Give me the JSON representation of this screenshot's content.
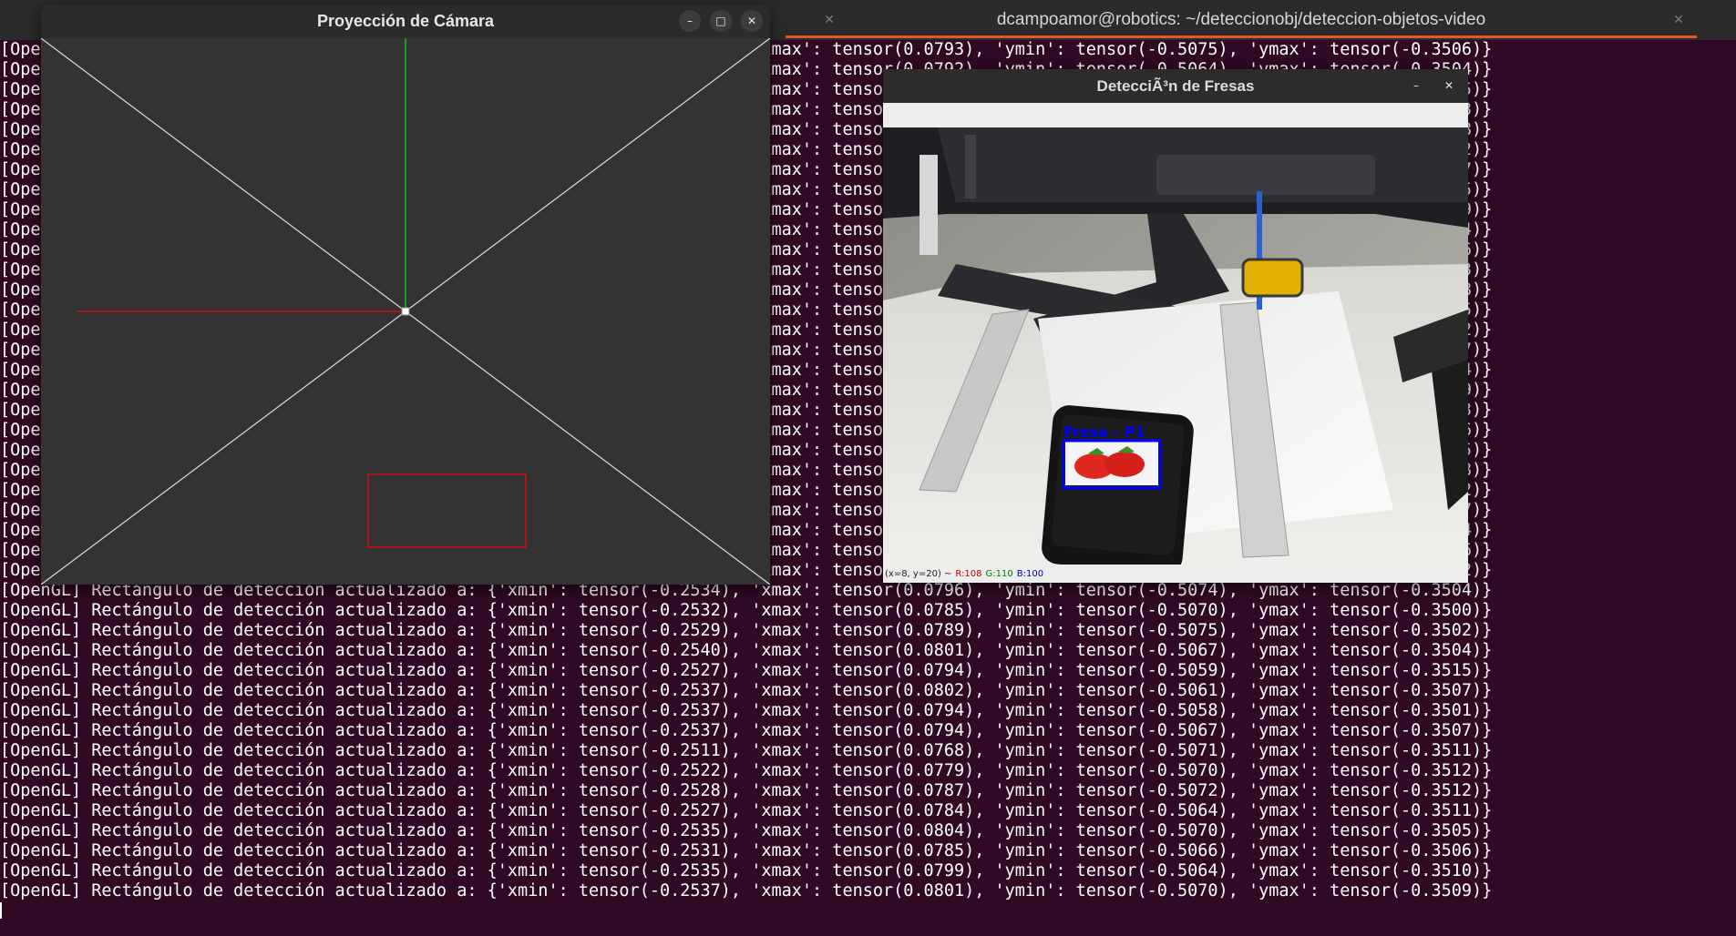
{
  "terminal": {
    "tab_title": "dcampoamor@robotics: ~/deteccionobj/deteccion-objetos-video",
    "line_prefix": "[OpenGL] Rectángulo de detección actualizado a: ",
    "lines": [
      "[OpenGL] Rectángulo de detección actualizado a: {'xmin': tensor(-0.2535), 'xmax': tensor(0.0793), 'ymin': tensor(-0.5075), 'ymax': tensor(-0.3506)}",
      "[OpenGL] Rectángulo de detección actualizado a: {'xmin': tensor(-0.2533), 'xmax': tensor(0.0792), 'ymin': tensor(-0.5064), 'ymax': tensor(-0.3504)}",
      "[OpenGL] Rectángulo de detección actualizado a: {'xmin': tensor(-0.2536), 'xmax': tensor(0.0795), 'ymin': tensor(-0.5068), 'ymax': tensor(-0.3505)}",
      "[OpenGL] Rectángulo de detección actualizado a: {'xmin': tensor(-0.2531), 'xmax': tensor(0.0790), 'ymin': tensor(-0.5071), 'ymax': tensor(-0.3503)}",
      "[OpenGL] Rectángulo de detección actualizado a: {'xmin': tensor(-0.2538), 'xmax': tensor(0.0797), 'ymin': tensor(-0.5066), 'ymax': tensor(-0.3508)}",
      "[OpenGL] Rectángulo de detección actualizado a: {'xmin': tensor(-0.2534), 'xmax': tensor(0.0791), 'ymin': tensor(-0.5072), 'ymax': tensor(-0.3502)}",
      "[OpenGL] Rectángulo de detección actualizado a: {'xmin': tensor(-0.2532), 'xmax': tensor(0.0794), 'ymin': tensor(-0.5069), 'ymax': tensor(-0.3507)}",
      "[OpenGL] Rectángulo de detección actualizado a: {'xmin': tensor(-0.2537), 'xmax': tensor(0.0796), 'ymin': tensor(-0.5063), 'ymax': tensor(-0.3505)}",
      "[OpenGL] Rectángulo de detección actualizado a: {'xmin': tensor(-0.2535), 'xmax': tensor(0.0789), 'ymin': tensor(-0.5070), 'ymax': tensor(-0.3509)}",
      "[OpenGL] Rectángulo de detección actualizado a: {'xmin': tensor(-0.2530), 'xmax': tensor(0.0798), 'ymin': tensor(-0.5067), 'ymax': tensor(-0.3504)}",
      "[OpenGL] Rectángulo de detección actualizado a: {'xmin': tensor(-0.2539), 'xmax': tensor(0.0793), 'ymin': tensor(-0.5074), 'ymax': tensor(-0.3506)}",
      "[OpenGL] Rectángulo de detección actualizado a: {'xmin': tensor(-0.2533), 'xmax': tensor(0.0795), 'ymin': tensor(-0.5061), 'ymax': tensor(-0.3503)}",
      "[OpenGL] Rectángulo de detección actualizado a: {'xmin': tensor(-0.2536), 'xmax': tensor(0.0792), 'ymin': tensor(-0.5068), 'ymax': tensor(-0.3508)}",
      "[OpenGL] Rectángulo de detección actualizado a: {'xmin': tensor(-0.2534), 'xmax': tensor(0.0790), 'ymin': tensor(-0.5073), 'ymax': tensor(-0.3505)}",
      "[OpenGL] Rectángulo de detección actualizado a: {'xmin': tensor(-0.2531), 'xmax': tensor(0.0797), 'ymin': tensor(-0.5065), 'ymax': tensor(-0.3502)}",
      "[OpenGL] Rectángulo de detección actualizado a: {'xmin': tensor(-0.2538), 'xmax': tensor(0.0794), 'ymin': tensor(-0.5070), 'ymax': tensor(-0.3507)}",
      "[OpenGL] Rectángulo de detección actualizado a: {'xmin': tensor(-0.2535), 'xmax': tensor(0.0791), 'ymin': tensor(-0.5066), 'ymax': tensor(-0.3504)}",
      "[OpenGL] Rectángulo de detección actualizado a: {'xmin': tensor(-0.2532), 'xmax': tensor(0.0796), 'ymin': tensor(-0.5072), 'ymax': tensor(-0.3509)}",
      "[OpenGL] Rectángulo de detección actualizado a: {'xmin': tensor(-0.2537), 'xmax': tensor(0.0793), 'ymin': tensor(-0.5064), 'ymax': tensor(-0.3503)}",
      "[OpenGL] Rectángulo de detección actualizado a: {'xmin': tensor(-0.2533), 'xmax': tensor(0.0789), 'ymin': tensor(-0.5069), 'ymax': tensor(-0.3506)}",
      "[OpenGL] Rectángulo de detección actualizado a: {'xmin': tensor(-0.2536), 'xmax': tensor(0.0798), 'ymin': tensor(-0.5071), 'ymax': tensor(-0.3505)}",
      "[OpenGL] Rectángulo de detección actualizado a: {'xmin': tensor(-0.2534), 'xmax': tensor(0.0792), 'ymin': tensor(-0.5067), 'ymax': tensor(-0.3508)}",
      "[OpenGL] Rectángulo de detección actualizado a: {'xmin': tensor(-0.2530), 'xmax': tensor(0.0795), 'ymin': tensor(-0.5063), 'ymax': tensor(-0.3502)}",
      "[OpenGL] Rectángulo de detección actualizado a: {'xmin': tensor(-0.2539), 'xmax': tensor(0.0790), 'ymin': tensor(-0.5074), 'ymax': tensor(-0.3507)}",
      "[OpenGL] Rectángulo de detección actualizado a: {'xmin': tensor(-0.2535), 'xmax': tensor(0.0794), 'ymin': tensor(-0.5066), 'ymax': tensor(-0.3504)}",
      "[OpenGL] Rectángulo de detección actualizado a: {'xmin': tensor(-0.2532), 'xmax': tensor(0.0797), 'ymin': tensor(-0.5070), 'ymax': tensor(-0.3506)}",
      "[OpenGL] Rectángulo de detección actualizado a: {'xmin': tensor(-0.2538), 'xmax': tensor(0.0797), 'ymin': tensor(-0.5061), 'ymax': tensor(-0.3502)}",
      "[OpenGL] Rectángulo de detección actualizado a: {'xmin': tensor(-0.2534), 'xmax': tensor(0.0796), 'ymin': tensor(-0.5074), 'ymax': tensor(-0.3504)}",
      "[OpenGL] Rectángulo de detección actualizado a: {'xmin': tensor(-0.2532), 'xmax': tensor(0.0785), 'ymin': tensor(-0.5070), 'ymax': tensor(-0.3500)}",
      "[OpenGL] Rectángulo de detección actualizado a: {'xmin': tensor(-0.2529), 'xmax': tensor(0.0789), 'ymin': tensor(-0.5075), 'ymax': tensor(-0.3502)}",
      "[OpenGL] Rectángulo de detección actualizado a: {'xmin': tensor(-0.2540), 'xmax': tensor(0.0801), 'ymin': tensor(-0.5067), 'ymax': tensor(-0.3504)}",
      "[OpenGL] Rectángulo de detección actualizado a: {'xmin': tensor(-0.2527), 'xmax': tensor(0.0794), 'ymin': tensor(-0.5059), 'ymax': tensor(-0.3515)}",
      "[OpenGL] Rectángulo de detección actualizado a: {'xmin': tensor(-0.2537), 'xmax': tensor(0.0802), 'ymin': tensor(-0.5061), 'ymax': tensor(-0.3507)}",
      "[OpenGL] Rectángulo de detección actualizado a: {'xmin': tensor(-0.2537), 'xmax': tensor(0.0794), 'ymin': tensor(-0.5058), 'ymax': tensor(-0.3501)}",
      "[OpenGL] Rectángulo de detección actualizado a: {'xmin': tensor(-0.2537), 'xmax': tensor(0.0794), 'ymin': tensor(-0.5067), 'ymax': tensor(-0.3507)}",
      "[OpenGL] Rectángulo de detección actualizado a: {'xmin': tensor(-0.2511), 'xmax': tensor(0.0768), 'ymin': tensor(-0.5071), 'ymax': tensor(-0.3511)}",
      "[OpenGL] Rectángulo de detección actualizado a: {'xmin': tensor(-0.2522), 'xmax': tensor(0.0779), 'ymin': tensor(-0.5070), 'ymax': tensor(-0.3512)}",
      "[OpenGL] Rectángulo de detección actualizado a: {'xmin': tensor(-0.2528), 'xmax': tensor(0.0787), 'ymin': tensor(-0.5072), 'ymax': tensor(-0.3512)}",
      "[OpenGL] Rectángulo de detección actualizado a: {'xmin': tensor(-0.2527), 'xmax': tensor(0.0784), 'ymin': tensor(-0.5064), 'ymax': tensor(-0.3511)}",
      "[OpenGL] Rectángulo de detección actualizado a: {'xmin': tensor(-0.2535), 'xmax': tensor(0.0804), 'ymin': tensor(-0.5070), 'ymax': tensor(-0.3505)}",
      "[OpenGL] Rectángulo de detección actualizado a: {'xmin': tensor(-0.2531), 'xmax': tensor(0.0785), 'ymin': tensor(-0.5066), 'ymax': tensor(-0.3506)}",
      "[OpenGL] Rectángulo de detección actualizado a: {'xmin': tensor(-0.2535), 'xmax': tensor(0.0799), 'ymin': tensor(-0.5064), 'ymax': tensor(-0.3510)}",
      "[OpenGL] Rectángulo de detección actualizado a: {'xmin': tensor(-0.2537), 'xmax': tensor(0.0801), 'ymin': tensor(-0.5070), 'ymax': tensor(-0.3509)}"
    ]
  },
  "projection_window": {
    "title": "Proyección de Cámara",
    "controls": {
      "minimize": "–",
      "maximize": "□",
      "close": "✕"
    },
    "colors": {
      "background": "#333333",
      "diagonals": "#e0e0e0",
      "x_axis": "#d01010",
      "y_axis": "#10c010",
      "detection_rect": "#d01010"
    }
  },
  "detection_window": {
    "title": "DetecciÃ³n de Fresas",
    "controls": {
      "minimize": "–",
      "close": "✕"
    },
    "detection_label": "Fresa - P1",
    "detection_color": "#0000ff",
    "status": {
      "coords": "(x=8, y=20) ~",
      "r": "R:108",
      "g": "G:110",
      "b": "B:100"
    }
  }
}
